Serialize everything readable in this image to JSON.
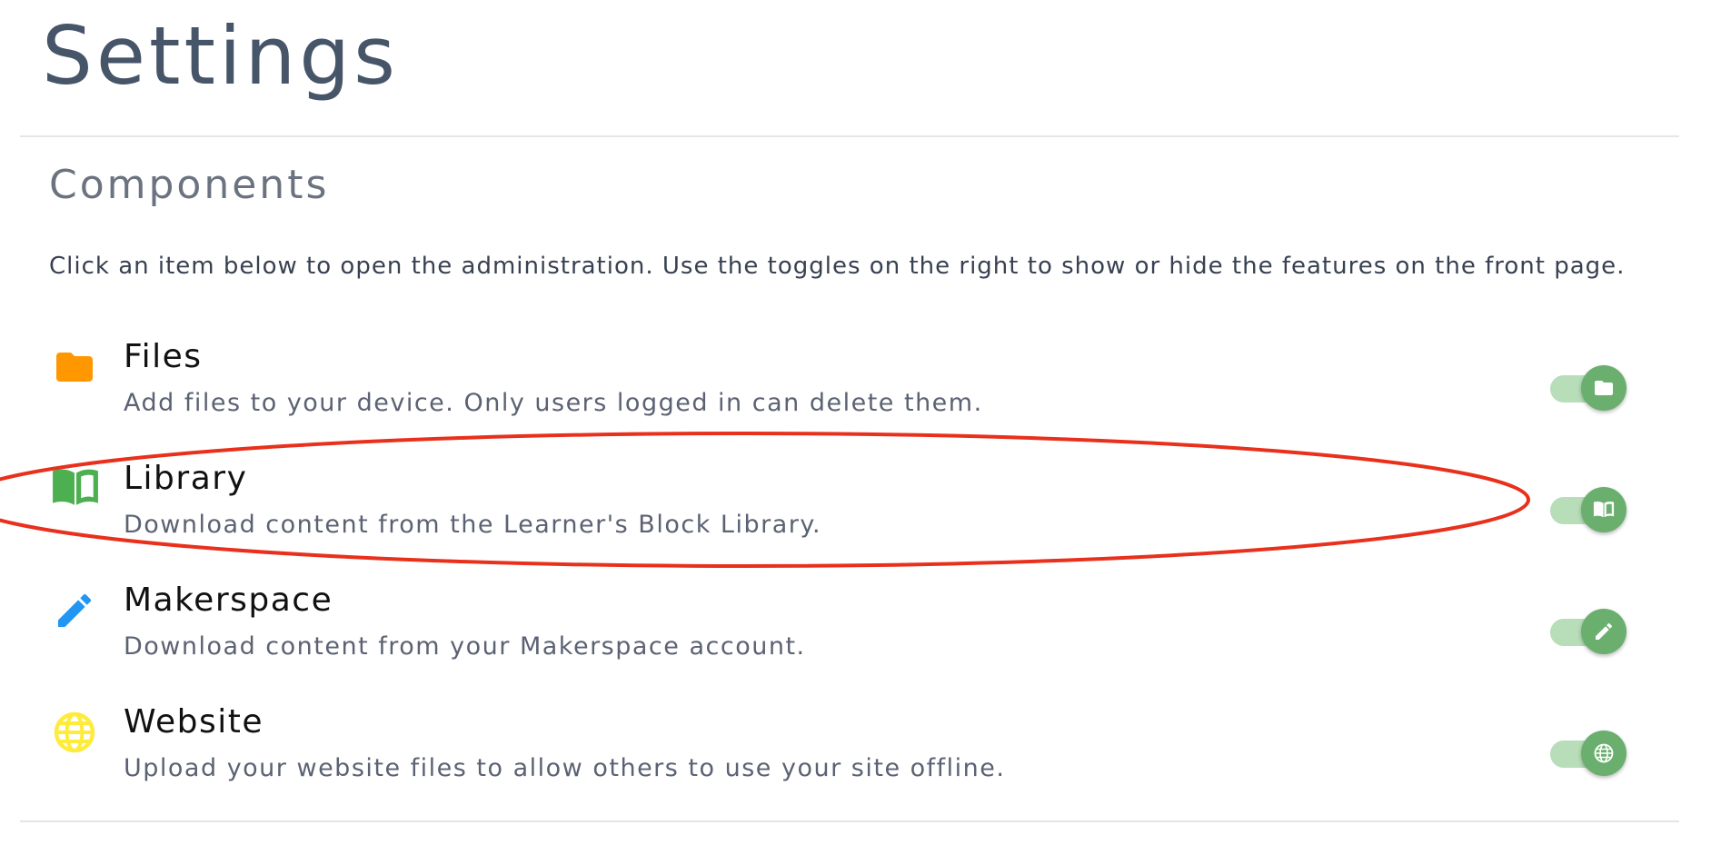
{
  "page": {
    "title": "Settings"
  },
  "components": {
    "heading": "Components",
    "intro": "Click an item below to open the administration. Use the toggles on the right to show or hide the features on the front page.",
    "items": [
      {
        "title": "Files",
        "description": "Add files to your device. Only users logged in can delete them.",
        "icon": "folder-icon",
        "icon_color": "#ff9800",
        "enabled": true
      },
      {
        "title": "Library",
        "description": "Download content from the Learner's Block Library.",
        "icon": "book-icon",
        "icon_color": "#4caf50",
        "enabled": true
      },
      {
        "title": "Makerspace",
        "description": "Download content from your Makerspace account.",
        "icon": "pencil-icon",
        "icon_color": "#2196f3",
        "enabled": true
      },
      {
        "title": "Website",
        "description": "Upload your website files to allow others to use your site offline.",
        "icon": "globe-icon",
        "icon_color": "#ffeb3b",
        "enabled": true
      }
    ]
  },
  "colors": {
    "toggle_on_knob": "#6aaf6e",
    "toggle_on_track": "#b7ddb9",
    "annotation_ellipse": "#e8301c"
  }
}
